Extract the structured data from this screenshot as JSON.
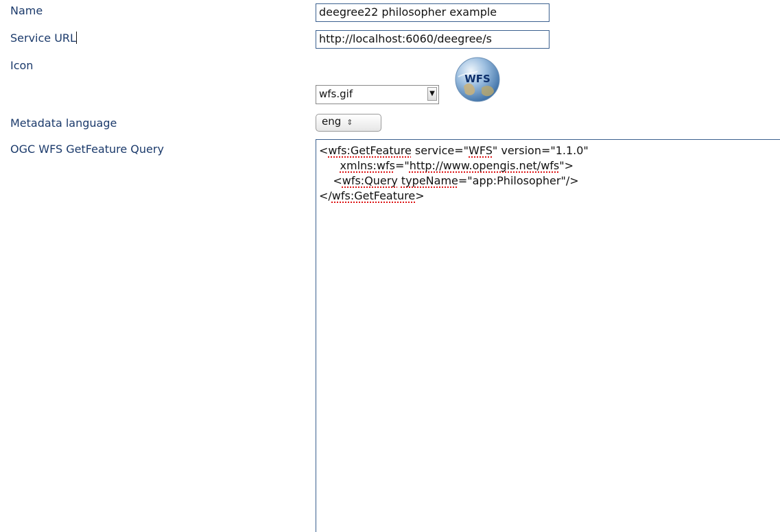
{
  "form": {
    "name_label": "Name",
    "name_value": "deegree22 philosopher example",
    "service_url_label": "Service URL",
    "service_url_value": "http://localhost:6060/deegree/s",
    "icon_label": "Icon",
    "icon_select_value": "wfs.gif",
    "icon_preview_text": "WFS",
    "metadata_language_label": "Metadata language",
    "metadata_language_value": "eng",
    "query_label": "OGC WFS GetFeature Query",
    "query_lines": {
      "l1_a": "<",
      "l1_b": "wfs:GetFeature",
      "l1_c": " service=\"",
      "l1_d": "WFS",
      "l1_e": "\" version=\"1.1.0\"",
      "l2_a": "      ",
      "l2_b": "xmlns:wfs",
      "l2_c": "=\"",
      "l2_d": "http://www.opengis.net/wfs",
      "l2_e": "\">",
      "l3_a": "    <",
      "l3_b": "wfs:Query",
      "l3_c": " ",
      "l3_d": "typeName",
      "l3_e": "=\"app:Philosopher\"/>",
      "l4_a": "</",
      "l4_b": "wfs:GetFeature",
      "l4_c": ">"
    }
  },
  "colors": {
    "label": "#1b3a6b",
    "field_border": "#3a5f8e",
    "spellcheck": "#dd1111"
  }
}
